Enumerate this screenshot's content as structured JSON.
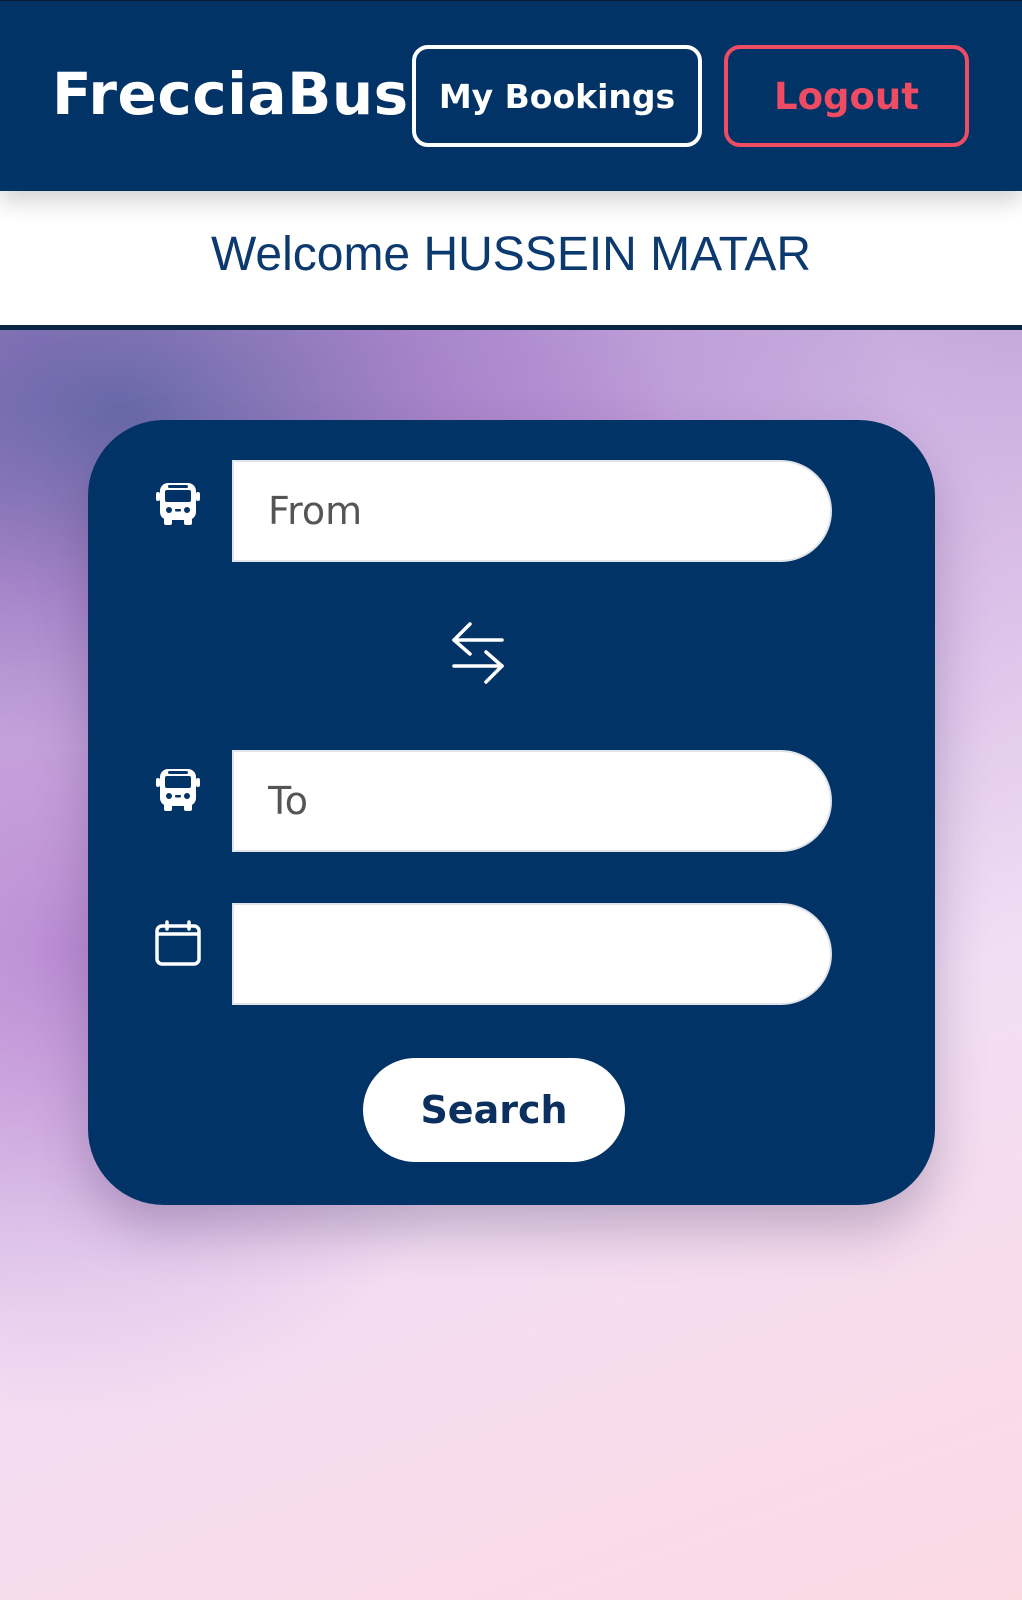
{
  "header": {
    "brand": "FrecciaBus",
    "my_bookings_label": "My Bookings",
    "logout_label": "Logout"
  },
  "welcome": {
    "text": "Welcome HUSSEIN MATAR"
  },
  "search_form": {
    "from": {
      "value": "",
      "placeholder": "From",
      "icon": "bus-icon"
    },
    "swap_icon": "swap-arrows-icon",
    "to": {
      "value": "",
      "placeholder": "To",
      "icon": "bus-icon"
    },
    "date": {
      "value": "",
      "placeholder": "",
      "icon": "calendar-icon"
    },
    "search_label": "Search"
  },
  "colors": {
    "primary": "#023366",
    "logout_accent": "#ef4b63",
    "welcome_text": "#0d3a6e"
  }
}
